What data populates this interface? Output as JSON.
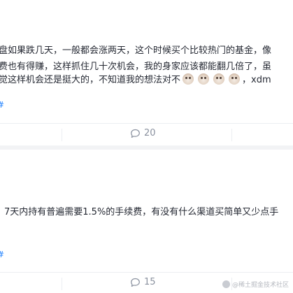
{
  "post1": {
    "lines": [
      "盘如果跌几天，一般都会涨两天，这个时候买个比较热门的基金，像",
      "费也有得赚，这样抓住几十次机会，我的身家应该都能翻几倍了，虽",
      "觉这样机会还是挺大的，不知道我的想法对不"
    ],
    "line3_suffix": "，xdm",
    "emoji_icons": [
      "doge-emoji",
      "doge-emoji",
      "doge-emoji",
      "doge-emoji"
    ],
    "tag_hash": "#",
    "comment_count": "20"
  },
  "post2": {
    "line": "7天内持有普遍需要1.5%的手续费，有没有什么渠道买简单又少点手",
    "tag_hash": "#",
    "comment_count": "15"
  },
  "watermark": "@稀土掘金技术社区",
  "colors": {
    "text": "#252933",
    "muted": "#8a919f",
    "link": "#1e80ff",
    "separator": "#f2f3f5"
  }
}
